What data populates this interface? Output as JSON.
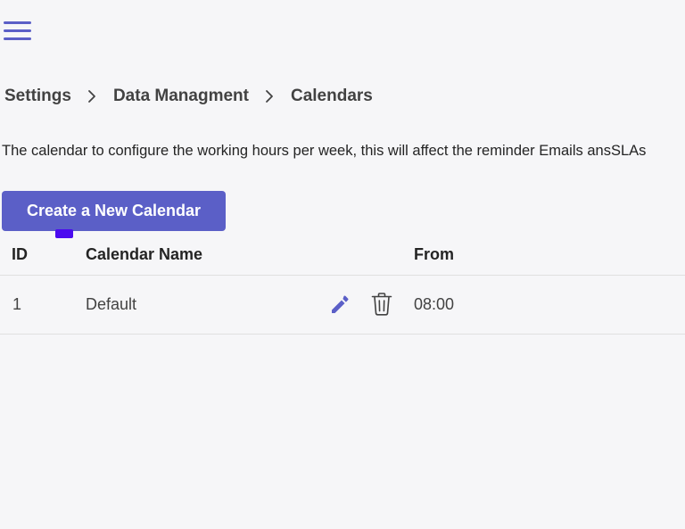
{
  "nav": {
    "menu_icon": "hamburger-menu-icon"
  },
  "breadcrumb": {
    "items": [
      "Settings",
      "Data Managment",
      "Calendars"
    ],
    "separator_icon": "chevron-right-icon"
  },
  "description": "The calendar to configure the working hours per week, this will affect the reminder Emails ansSLAs",
  "actions": {
    "create_label": "Create a New Calendar"
  },
  "table": {
    "columns": {
      "id": "ID",
      "name": "Calendar Name",
      "from": "From"
    },
    "rows": [
      {
        "id": "1",
        "name": "Default",
        "from": "08:00",
        "edit_icon": "pencil-icon",
        "delete_icon": "trash-icon"
      }
    ]
  },
  "colors": {
    "accent": "#5b5fc7",
    "focus_marker": "#4b0aef",
    "background": "#f6f6f8",
    "divider": "#e0e0e0"
  }
}
